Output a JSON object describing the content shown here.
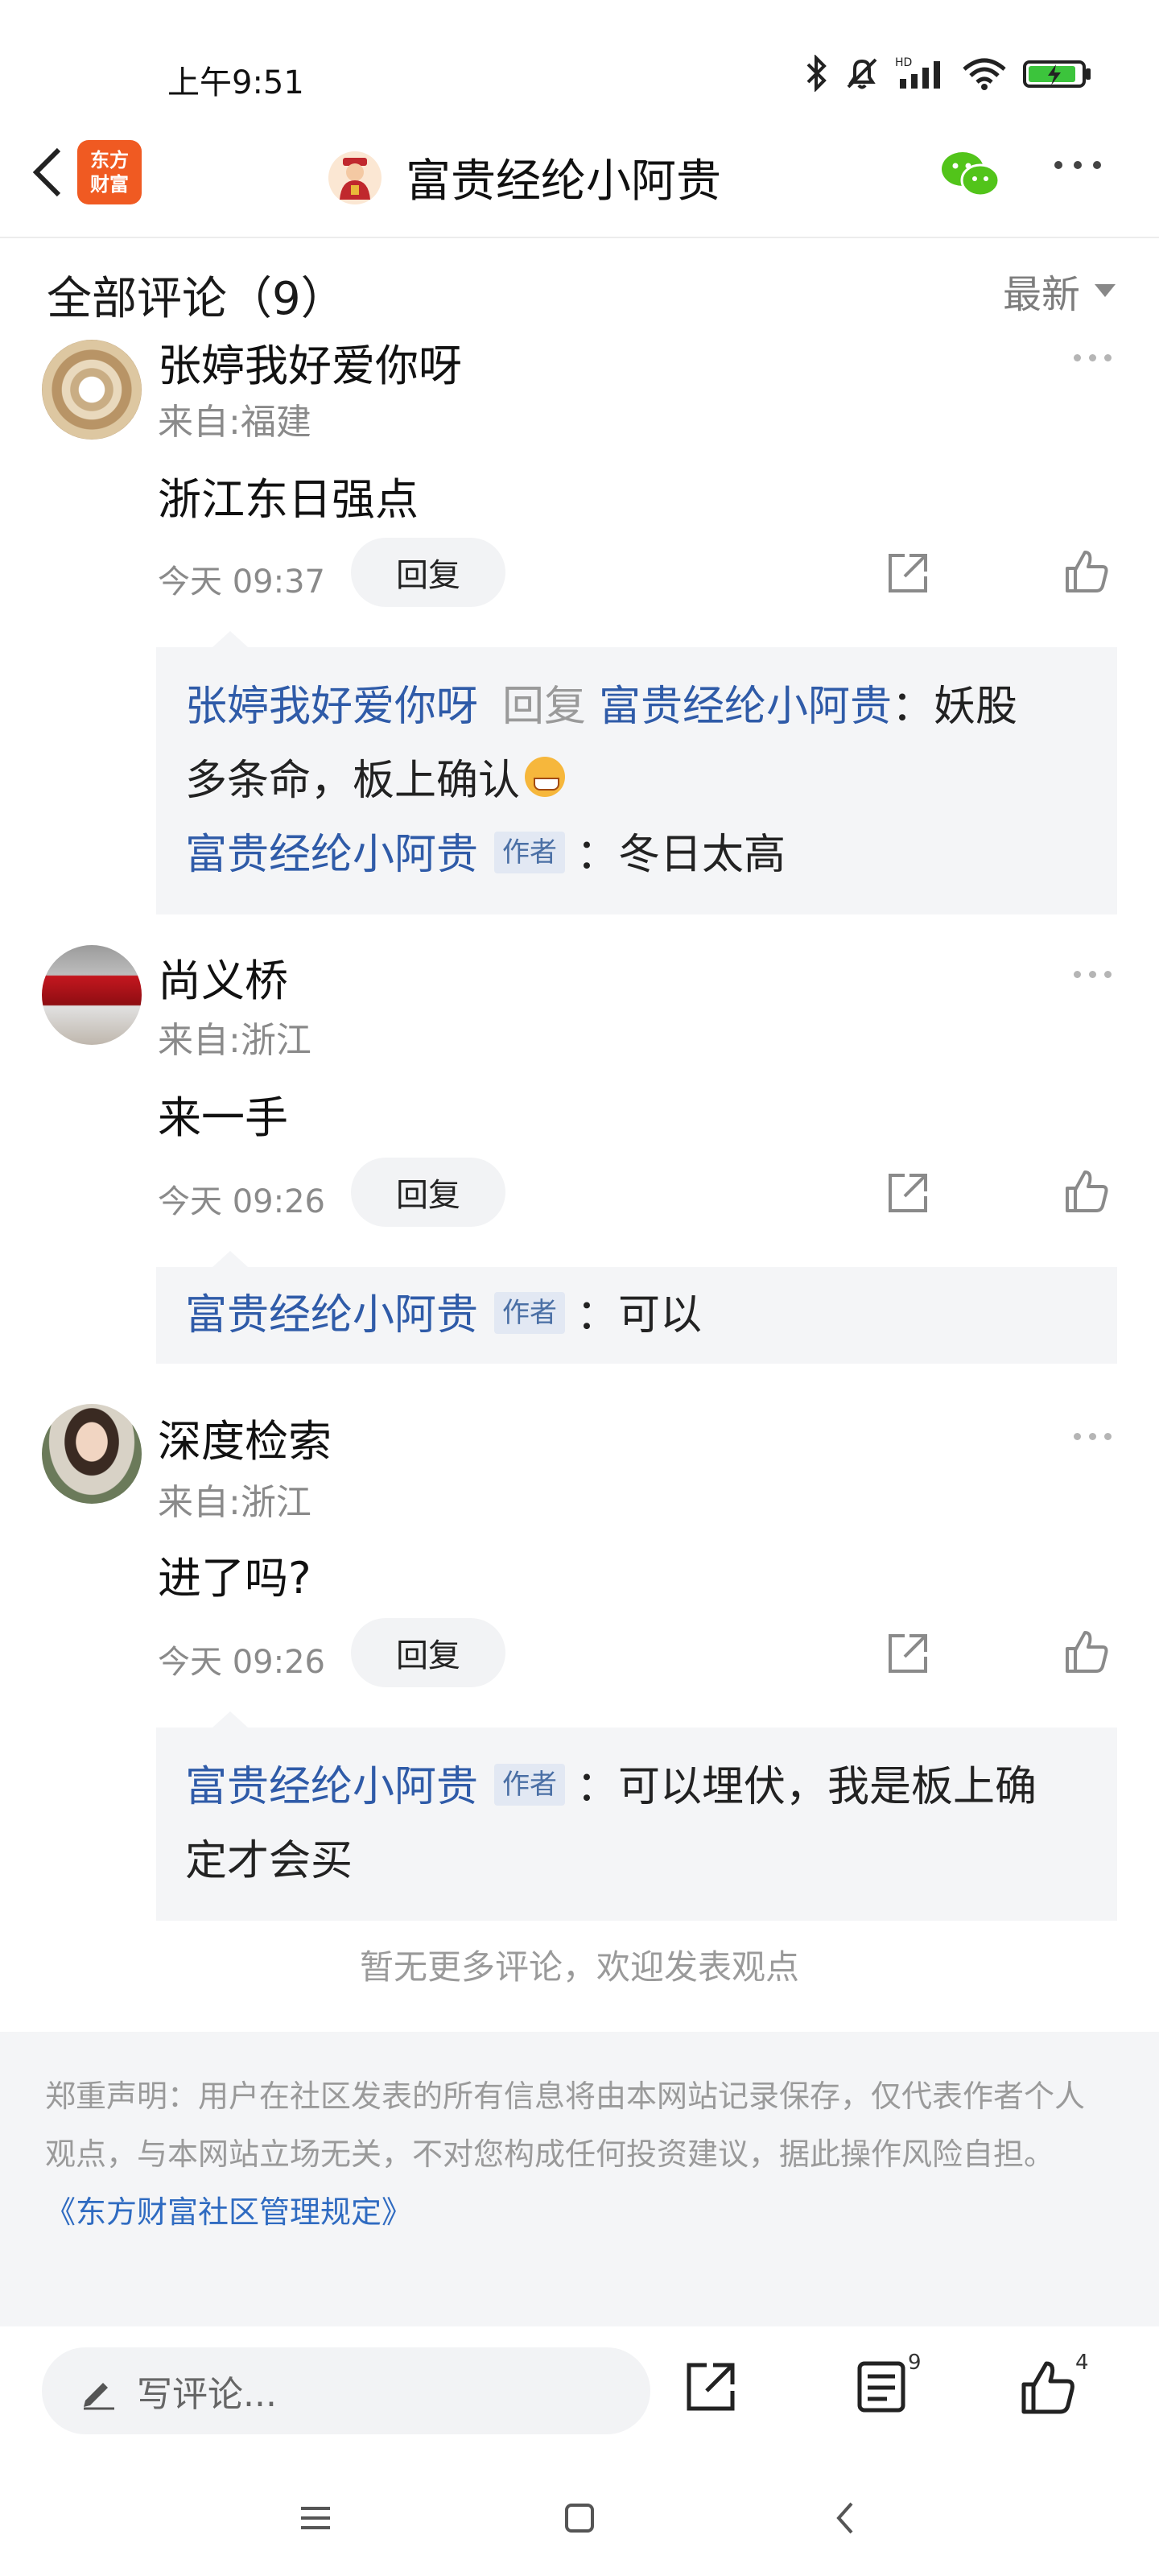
{
  "status_bar": {
    "time": "上午9:51",
    "battery_color": "#3cc43c"
  },
  "nav": {
    "logo_line1": "东方",
    "logo_line2": "财富",
    "title": "富贵经纶小阿贵",
    "wechat_color": "#52c41a"
  },
  "header": {
    "title": "全部评论（9）",
    "sort": "最新"
  },
  "comments": [
    {
      "name": "张婷我好爱你呀",
      "region": "来自:福建",
      "text": "浙江东日强点",
      "time": "今天 09:37",
      "reply_label": "回复",
      "replies": [
        {
          "from": "张婷我好爱你呀",
          "verb": "回复",
          "to": "富贵经纶小阿贵",
          "text_line1": "：妖股",
          "text_line2": "多条命，板上确认"
        },
        {
          "from": "富贵经纶小阿贵",
          "badge": "作者",
          "text": "：冬日太高"
        }
      ]
    },
    {
      "name": "尚义桥",
      "region": "来自:浙江",
      "text": "来一手",
      "time": "今天 09:26",
      "reply_label": "回复",
      "replies": [
        {
          "from": "富贵经纶小阿贵",
          "badge": "作者",
          "text": "：可以"
        }
      ]
    },
    {
      "name": "深度检索",
      "region": "来自:浙江",
      "text": "进了吗?",
      "time": "今天 09:26",
      "reply_label": "回复",
      "replies": [
        {
          "from": "富贵经纶小阿贵",
          "badge": "作者",
          "text_line1": "：可以埋伏，我是板上确",
          "text_line2": "定才会买"
        }
      ]
    }
  ],
  "end_note": "暂无更多评论，欢迎发表观点",
  "disclaimer": {
    "text": "郑重声明：用户在社区发表的所有信息将由本网站记录保存，仅代表作者个人观点，与本网站立场无关，不对您构成任何投资建议，据此操作风险自担。",
    "link": "《东方财富社区管理规定》"
  },
  "bottom_bar": {
    "input_placeholder": "写评论...",
    "comment_count": "9",
    "like_count": "4"
  }
}
